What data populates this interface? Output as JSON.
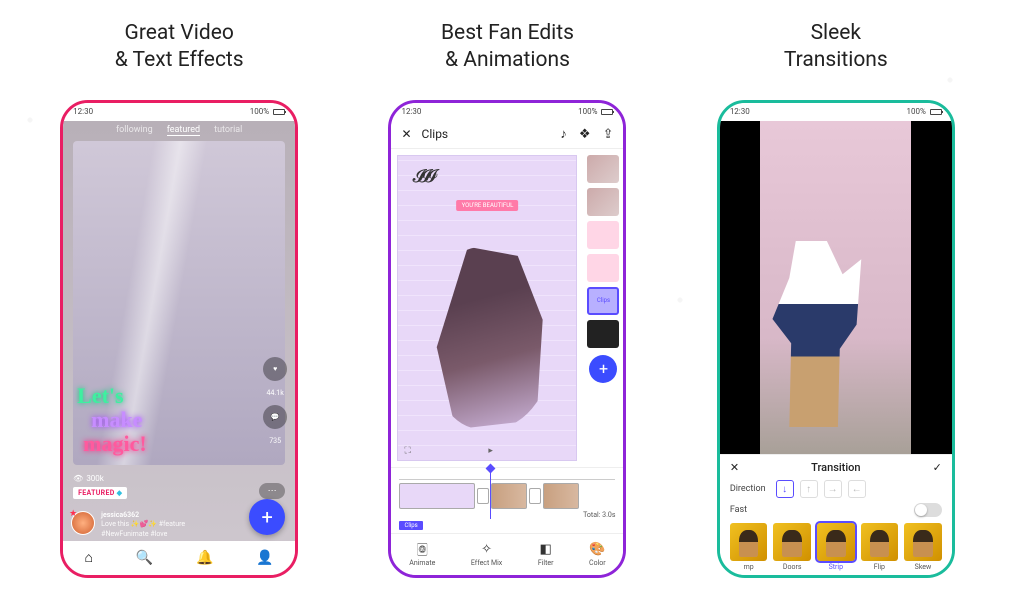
{
  "headings": {
    "col1": "Great Video\n& Text Effects",
    "col2": "Best Fan Edits\n& Animations",
    "col3": "Sleek\nTransitions"
  },
  "status": {
    "time": "12:30",
    "battery": "100%"
  },
  "phone1": {
    "tabs": {
      "following": "following",
      "featured": "featured",
      "tutorial": "tutorial"
    },
    "neon": {
      "l1": "Let's",
      "l2": "make",
      "l3": "magic!"
    },
    "likes": "44.1k",
    "comments": "735",
    "views": "300k",
    "featured_badge": "FEATURED",
    "username": "jessica6362",
    "caption": "Love this ✨💕✨ #feature",
    "hashtags": "#NewFunimate #love",
    "fab": "+"
  },
  "phone2": {
    "header": {
      "close": "✕",
      "title": "Clips"
    },
    "overlay_label": "YOU'RE BEAUTIFUL",
    "selected_thumb": "Clips",
    "add": "+",
    "total": "Total: 3.0s",
    "clips_tag": "Clips",
    "tools": {
      "animate": "Animate",
      "effect": "Effect Mix",
      "filter": "Filter",
      "color": "Color"
    }
  },
  "phone3": {
    "panel_title": "Transition",
    "close": "✕",
    "confirm": "✓",
    "direction_label": "Direction",
    "fast_label": "Fast",
    "transitions": {
      "t0": "mp",
      "t1": "Doors",
      "t2": "Strip",
      "t3": "Flip",
      "t4": "Skew"
    }
  }
}
